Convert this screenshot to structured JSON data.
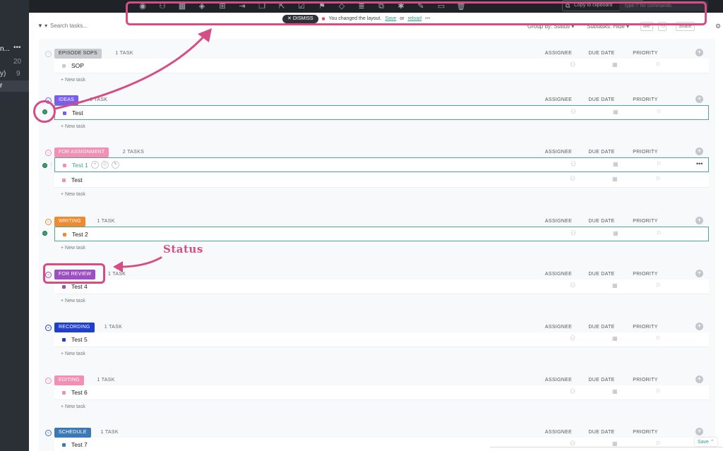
{
  "sidebar": {
    "item_a": "n...",
    "item_a_dots": "•••",
    "count_a": "20",
    "item_b": "y)",
    "count_b": "9",
    "item_c": "r"
  },
  "toolbar": {
    "icons": [
      "eye-icon",
      "assign-user-icon",
      "calculator-icon",
      "tag-icon",
      "hierarchy-icon",
      "move-icon",
      "duplicate-icon",
      "export-icon",
      "checkbox-icon",
      "flag-icon",
      "tag-outline-icon",
      "stack-icon",
      "copy-icon",
      "link-icon",
      "edit-icon",
      "inbox-icon",
      "trash-icon"
    ],
    "copy_label": "Copy to clipboard",
    "command_placeholder": "type '/' for commands"
  },
  "notice": {
    "dismiss_label": "DISMISS",
    "message": "You changed the layout.",
    "save_link": "Save",
    "or_text": "or",
    "reload_link": "reload",
    "more": "•••"
  },
  "filterbar": {
    "search_placeholder": "Search tasks...",
    "group_by": "Group by: Status ▾",
    "subtasks": "Subtasks: Hide ▾",
    "me_label": "Me",
    "share_label": "Share"
  },
  "columns": {
    "assignee": "ASSIGNEE",
    "due_date": "DUE DATE",
    "priority": "PRIORITY"
  },
  "new_task_label": "+ New task",
  "groups": [
    {
      "name": "EPISODE SOPS",
      "count": "1 TASK",
      "color": "#c9cbd0",
      "text_color": "#333333",
      "tasks": [
        {
          "name": "SOP",
          "color": "#c9cbd0"
        }
      ]
    },
    {
      "name": "IDEAS",
      "count": "1 TASK",
      "color": "#7b5cf0",
      "text_color": "#ffffff",
      "tasks": [
        {
          "name": "Test",
          "color": "#7b5cf0"
        }
      ]
    },
    {
      "name": "FOR ASSIGNMENT",
      "count": "2 TASKS",
      "color": "#f38fb3",
      "text_color": "#ffffff",
      "tasks": [
        {
          "name": "Test 1",
          "color": "#f38fb3"
        },
        {
          "name": "Test",
          "color": "#f38fb3"
        }
      ]
    },
    {
      "name": "WRITING",
      "count": "1 TASK",
      "color": "#f08a30",
      "text_color": "#ffffff",
      "tasks": [
        {
          "name": "Test 2",
          "color": "#f08a30"
        }
      ]
    },
    {
      "name": "FOR REVIEW",
      "count": "1 TASK",
      "color": "#9b4fc0",
      "text_color": "#ffffff",
      "tasks": [
        {
          "name": "Test 4",
          "color": "#9b4fc0"
        }
      ]
    },
    {
      "name": "RECORDING",
      "count": "1 TASK",
      "color": "#1f3fcf",
      "text_color": "#ffffff",
      "tasks": [
        {
          "name": "Test 5",
          "color": "#1f3fcf"
        }
      ]
    },
    {
      "name": "EDITING",
      "count": "1 TASK",
      "color": "#f38fb3",
      "text_color": "#ffffff",
      "tasks": [
        {
          "name": "Test 6",
          "color": "#f38fb3"
        }
      ]
    },
    {
      "name": "SCHEDULE",
      "count": "1 TASK",
      "color": "#3d78b5",
      "text_color": "#ffffff",
      "tasks": [
        {
          "name": "Test 7",
          "color": "#3d78b5"
        }
      ]
    }
  ],
  "annotation": {
    "label": "Status",
    "color": "#d64d86"
  },
  "footer": {
    "save_label": "Save ⌃"
  }
}
